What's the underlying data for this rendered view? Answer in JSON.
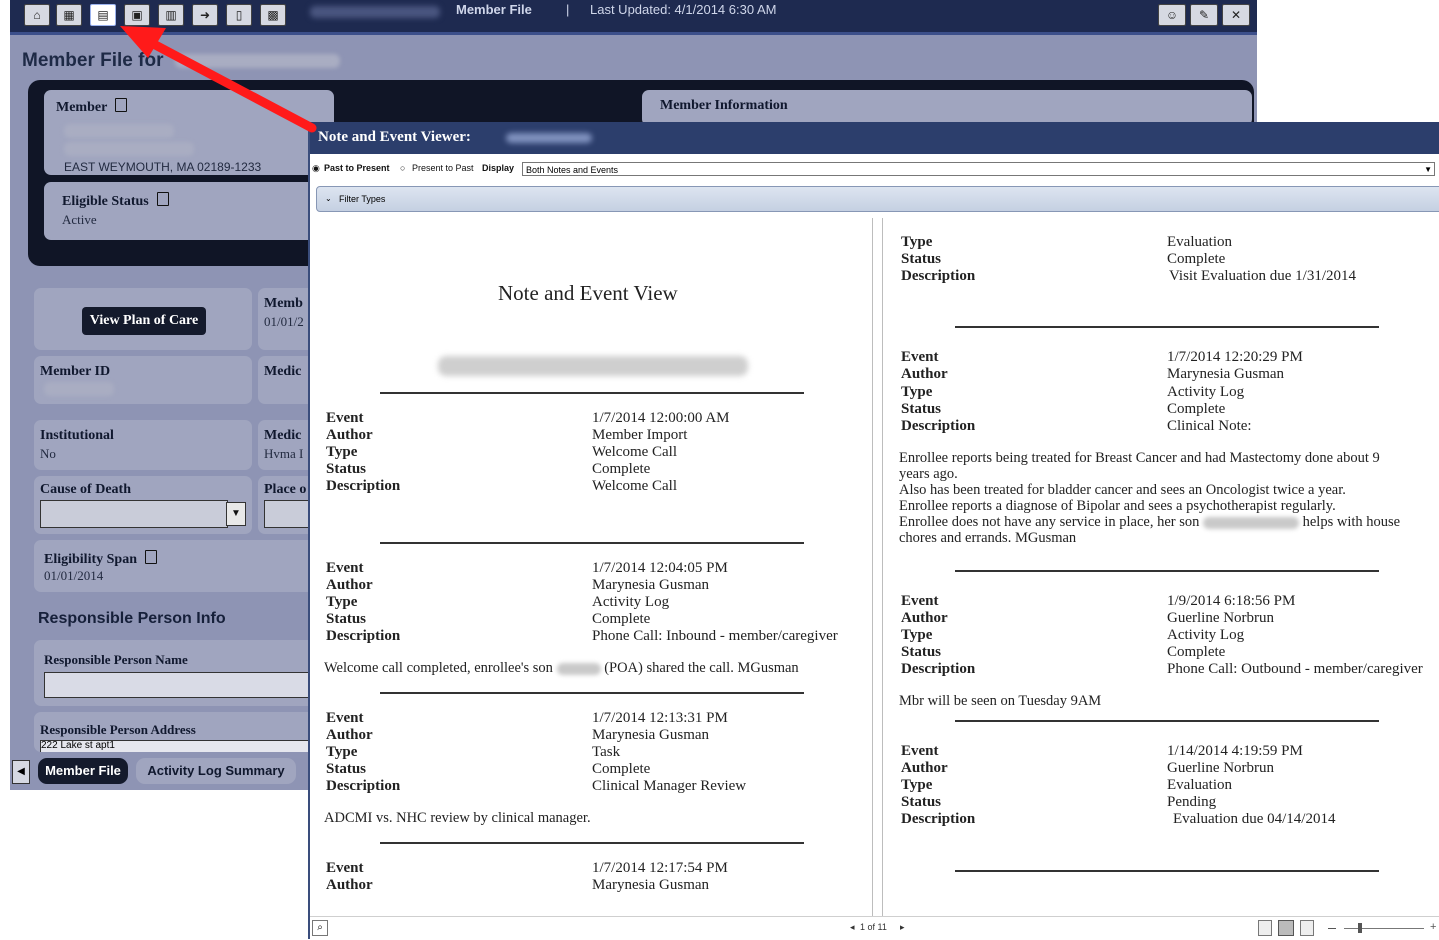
{
  "background_app": {
    "toolbar": {
      "title": "Member File",
      "separator": "|",
      "last_updated": "Last Updated: 4/1/2014 6:30 AM",
      "button_icons": [
        "home-icon",
        "grid-icon",
        "notes-viewer-icon",
        "calendar-icon",
        "folder-icon",
        "arrow-icon",
        "document-icon",
        "chart-icon"
      ],
      "right_icons": [
        "user-icon",
        "edit-icon",
        "close-icon"
      ]
    },
    "page_heading": "Member File for",
    "member_card": {
      "label": "Member",
      "address": "EAST WEYMOUTH, MA 02189-1233"
    },
    "eligible_status": {
      "label": "Eligible Status",
      "value": "Active"
    },
    "member_information_label": "Member Information",
    "view_plan_button": "View Plan of Care",
    "member_partial": {
      "label": "Memb",
      "value": "01/01/2"
    },
    "member_id_label": "Member ID",
    "medicaid_partial": "Medic",
    "institutional": {
      "label": "Institutional",
      "value": "No"
    },
    "medic_partial_2": {
      "label": "Medic",
      "value": "Hvma I"
    },
    "cause_of_death_label": "Cause of Death",
    "place_partial": "Place o",
    "eligibility_span": {
      "label": "Eligibility Span",
      "value": "01/01/2014"
    },
    "responsible_heading": "Responsible Person Info",
    "responsible_name_label": "Responsible Person Name",
    "responsible_address_label": "Responsible Person Address",
    "responsible_address_value": "222 Lake st apt1",
    "tabs": [
      "Member File",
      "Activity Log Summary"
    ]
  },
  "viewer": {
    "title": "Note and Event Viewer:",
    "options": {
      "past_to_present": "Past to Present",
      "present_to_past": "Present to Past",
      "display_label": "Display",
      "display_value": "Both Notes and Events"
    },
    "filter_label": "Filter Types",
    "doc_title": "Note and Event View",
    "labels": {
      "event": "Event",
      "author": "Author",
      "type": "Type",
      "status": "Status",
      "description": "Description"
    },
    "left_entries": [
      {
        "event": "1/7/2014 12:00:00 AM",
        "author": "Member Import",
        "type": "Welcome Call",
        "status": "Complete",
        "description": "Welcome Call",
        "note": ""
      },
      {
        "event": "1/7/2014 12:04:05 PM",
        "author": "Marynesia Gusman",
        "type": "Activity Log",
        "status": "Complete",
        "description": "Phone Call: Inbound - member/caregiver",
        "note_prefix": "Welcome call completed, enrollee's son",
        "note_suffix": "(POA) shared the call.  MGusman"
      },
      {
        "event": "1/7/2014 12:13:31 PM",
        "author": "Marynesia Gusman",
        "type": "Task",
        "status": "Complete",
        "description": "Clinical Manager Review",
        "note": "ADCMI vs. NHC review by clinical manager."
      },
      {
        "event": "1/7/2014 12:17:54 PM",
        "author": "Marynesia Gusman"
      }
    ],
    "right_entries": [
      {
        "type": "Evaluation",
        "status": "Complete",
        "description": "Visit Evaluation due 1/31/2014"
      },
      {
        "event": "1/7/2014 12:20:29 PM",
        "author": "Marynesia Gusman",
        "type": "Activity Log",
        "status": "Complete",
        "description": "Clinical Note:",
        "note_lines": [
          "Enrollee reports being treated for Breast Cancer and had Mastectomy done about 9",
          "years ago.",
          "Also has been treated for bladder cancer and sees an Oncologist twice a year.",
          "Enrollee reports a diagnose of Bipolar and sees a psychotherapist regularly."
        ],
        "note_line5_prefix": "Enrollee does not have any service in place, her son",
        "note_line5_suffix": "helps with house",
        "note_line6": "chores and errands. MGusman"
      },
      {
        "event": "1/9/2014 6:18:56 PM",
        "author": "Guerline Norbrun",
        "type": "Activity Log",
        "status": "Complete",
        "description": "Phone Call: Outbound - member/caregiver",
        "note": "Mbr will be seen on Tuesday 9AM"
      },
      {
        "event": "1/14/2014 4:19:59 PM",
        "author": "Guerline Norbrun",
        "type": "Evaluation",
        "status": "Pending",
        "description": "Evaluation due 04/14/2014"
      }
    ],
    "statusbar": {
      "page": "1 of 11",
      "search_icon": "search-icon",
      "view_icons": [
        "single-page-icon",
        "two-page-icon",
        "grid-view-icon"
      ]
    }
  },
  "colors": {
    "accent_arrow": "#ff1a1a",
    "viewer_title_bg": "#2c3e6c",
    "app_bg": "#8e94b4"
  }
}
